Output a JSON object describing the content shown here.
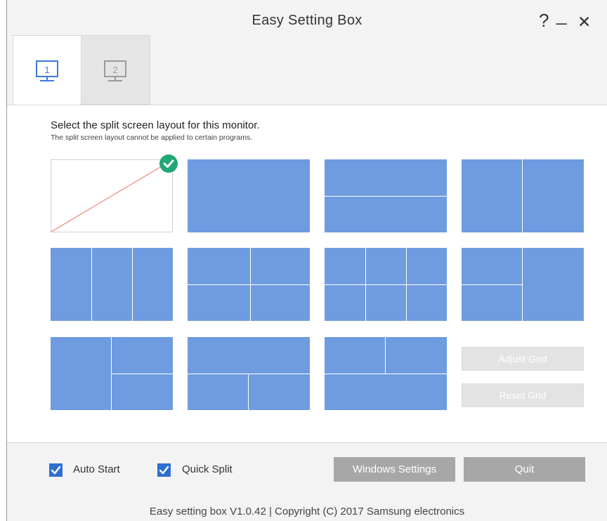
{
  "window": {
    "title": "Easy Setting Box",
    "help_label": "?",
    "minimize_label": "_",
    "close_label": "✕"
  },
  "monitor_tabs": [
    {
      "number": "1",
      "selected": true
    },
    {
      "number": "2",
      "selected": false
    }
  ],
  "content": {
    "heading": "Select the split screen layout for this monitor.",
    "subheading": "The split screen layout cannot be applied to certain programs."
  },
  "layouts": [
    {
      "name": "no-split",
      "selected": true
    },
    {
      "name": "single-full"
    },
    {
      "name": "two-rows"
    },
    {
      "name": "two-columns"
    },
    {
      "name": "three-columns"
    },
    {
      "name": "four-quad"
    },
    {
      "name": "six-grid"
    },
    {
      "name": "left-stack-right-large"
    },
    {
      "name": "left-large-right-stack"
    },
    {
      "name": "top-large-bottom-two"
    },
    {
      "name": "top-two-bottom-large"
    }
  ],
  "grid_buttons": {
    "adjust": "Adjust Grid",
    "reset": "Reset Grid"
  },
  "options": {
    "auto_start": {
      "label": "Auto Start",
      "checked": true
    },
    "quick_split": {
      "label": "Quick Split",
      "checked": true
    }
  },
  "actions": {
    "windows_settings": "Windows Settings",
    "quit": "Quit"
  },
  "footer": "Easy setting box V1.0.42 | Copyright (C) 2017 Samsung electronics",
  "colors": {
    "layout_fill": "#6f9be0",
    "check_green": "#1fa875",
    "checkbox_blue": "#2f6fd0",
    "button_gray": "#a7a7a7"
  }
}
